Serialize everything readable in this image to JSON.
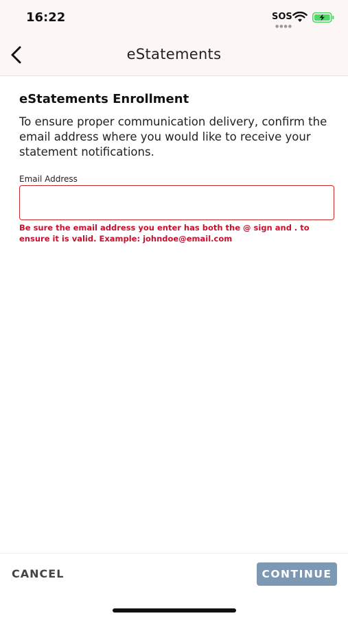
{
  "status_bar": {
    "time": "16:22",
    "sos": "SOS",
    "battery_color": "#4cd964"
  },
  "nav": {
    "back_icon": "chevron-left-icon",
    "title": "eStatements"
  },
  "enrollment": {
    "heading": "eStatements Enrollment",
    "description": "To ensure proper communication delivery, confirm the email address where you would like to receive your statement notifications.",
    "email_label": "Email Address",
    "email_value": "",
    "email_placeholder": "",
    "error_message": "Be sure the email address you enter has both the @ sign and . to ensure it is valid. Example: johndoe@email.com",
    "error_color": "#c8102e"
  },
  "actions": {
    "cancel_label": "CANCEL",
    "continue_label": "CONTINUE",
    "continue_color": "#7d98b3"
  }
}
